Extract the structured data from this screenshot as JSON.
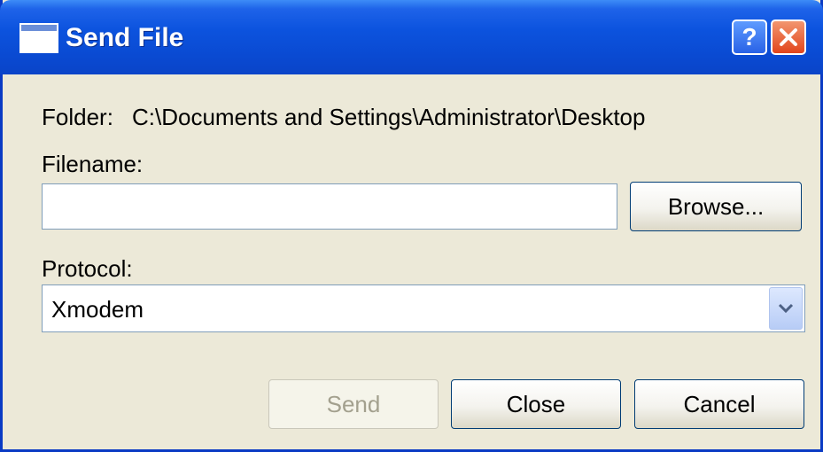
{
  "window": {
    "title": "Send File",
    "help_glyph": "?"
  },
  "folder": {
    "label": "Folder:",
    "value": "C:\\Documents and Settings\\Administrator\\Desktop"
  },
  "filename": {
    "label": "Filename:",
    "value": "",
    "browse_label": "Browse..."
  },
  "protocol": {
    "label": "Protocol:",
    "selected": "Xmodem"
  },
  "actions": {
    "send_label": "Send",
    "close_label": "Close",
    "cancel_label": "Cancel"
  },
  "icons": {
    "app": "window-icon",
    "help": "help-icon",
    "close": "close-icon",
    "dropdown": "chevron-down-icon"
  },
  "colors": {
    "titlebar": "#0a4ad2",
    "window_bg": "#ece9d8",
    "close_button": "#e2451c",
    "disabled_text": "#a3a08e"
  }
}
